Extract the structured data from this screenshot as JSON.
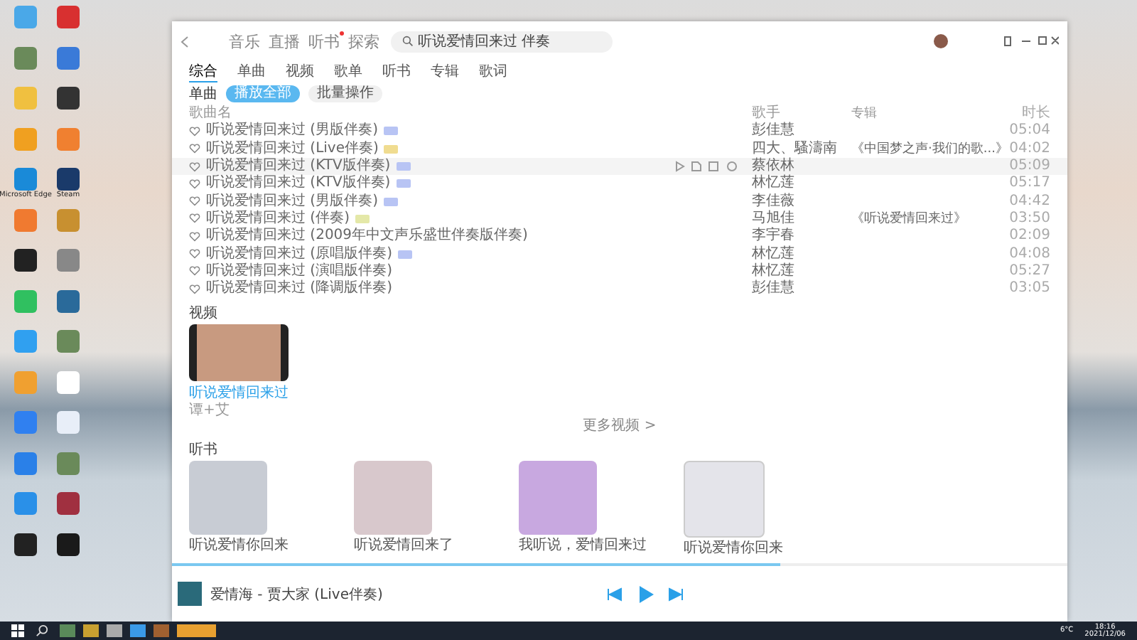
{
  "desktop_icons": [
    {
      "color": "#4aa8e8"
    },
    {
      "color": "#d83030"
    },
    {
      "color": "#6a8a5a"
    },
    {
      "color": "#3a7ad8"
    },
    {
      "color": "#f0c040"
    },
    {
      "color": "#333333"
    },
    {
      "color": "#f0a020"
    },
    {
      "color": "#f08030"
    },
    {
      "color": "#1a8ad8",
      "label": "Microsoft Edge"
    },
    {
      "color": "#1a3a6a",
      "label": "Steam"
    },
    {
      "color": "#f07a30"
    },
    {
      "color": "#c89030"
    },
    {
      "color": "#222222"
    },
    {
      "color": "#888888"
    },
    {
      "color": "#30c060"
    },
    {
      "color": "#2a6a9a"
    },
    {
      "color": "#30a0f0"
    },
    {
      "color": "#6a8a5a"
    },
    {
      "color": "#f0a030"
    },
    {
      "color": "#ffffff"
    },
    {
      "color": "#3080f0"
    },
    {
      "color": "#e8eef8"
    },
    {
      "color": "#2a80e8"
    },
    {
      "color": "#6a8a5a"
    },
    {
      "color": "#2a90e8"
    },
    {
      "color": "#a03040"
    },
    {
      "color": "#222222"
    },
    {
      "color": "#1a1a1a"
    }
  ],
  "window": {
    "nav": [
      {
        "label": "音乐",
        "dot": false
      },
      {
        "label": "直播",
        "dot": false
      },
      {
        "label": "听书",
        "dot": true
      },
      {
        "label": "探索",
        "dot": false
      }
    ],
    "search": {
      "value": "听说爱情回来过 伴奏"
    },
    "tabs": [
      {
        "label": "综合",
        "selected": true
      },
      {
        "label": "单曲",
        "selected": false
      },
      {
        "label": "视频",
        "selected": false
      },
      {
        "label": "歌单",
        "selected": false
      },
      {
        "label": "听书",
        "selected": false
      },
      {
        "label": "专辑",
        "selected": false
      },
      {
        "label": "歌词",
        "selected": false
      }
    ],
    "section_label": "单曲",
    "buttons": [
      "播放全部",
      "批量操作"
    ],
    "columns": [
      "歌曲名",
      "歌手",
      "专辑",
      "时长"
    ],
    "rows": [
      {
        "title": "听说爱情回来过 (男版伴奏)",
        "color": "#b8c4f4",
        "artist": "彭佳慧",
        "album": "",
        "time": "05:04",
        "hovered": false
      },
      {
        "title": "听说爱情回来过 (Live伴奏)",
        "color": "#f0dc90",
        "artist": "四大、騷濤南",
        "album": "《中国梦之声·我们的歌...》",
        "time": "04:02",
        "hovered": false
      },
      {
        "title": "听说爱情回来过 (KTV版伴奏)",
        "color": "#b8c4f4",
        "artist": "蔡依林",
        "album": "",
        "time": "05:09",
        "hovered": true
      },
      {
        "title": "听说爱情回来过 (KTV版伴奏)",
        "color": "#b8c4f4",
        "artist": "林忆莲",
        "album": "",
        "time": "05:17",
        "hovered": false
      },
      {
        "title": "听说爱情回来过 (男版伴奏)",
        "color": "#b8c4f4",
        "artist": "李佳薇",
        "album": "",
        "time": "04:42",
        "hovered": false
      },
      {
        "title": "听说爱情回来过 (伴奏)",
        "color": "#e4e8a8",
        "artist": "马旭佳",
        "album": "《听说爱情回来过》",
        "time": "03:50",
        "hovered": false
      },
      {
        "title": "听说爱情回来过 (2009年中文声乐盛世伴奏版伴奏)",
        "artist": "李宇春",
        "album": "",
        "time": "02:09",
        "hovered": false
      },
      {
        "title": "听说爱情回来过 (原唱版伴奏)",
        "color": "#b8c4f4",
        "artist": "林忆莲",
        "album": "",
        "time": "04:08",
        "hovered": false
      },
      {
        "title": "听说爱情回来过 (演唱版伴奏)",
        "artist": "林忆莲",
        "album": "",
        "time": "05:27",
        "hovered": false
      },
      {
        "title": "听说爱情回来过 (降调版伴奏)",
        "artist": "彭佳慧",
        "album": "",
        "time": "03:05",
        "hovered": false
      }
    ],
    "video": {
      "heading": "视频",
      "title": "听说爱情回来过",
      "sub": "谭+艾",
      "more": "更多视频 >"
    },
    "books": {
      "heading": "听书",
      "items": [
        "听说爱情你回来",
        "听说爱情回来了",
        "我听说，爱情回来过",
        "听说爱情你回来"
      ]
    },
    "player": {
      "title": "爱情海 - 贾大家 (Live伴奏)",
      "level": 0.68
    }
  },
  "taskbar": {
    "weather": "6°C",
    "time": "18:16",
    "date": "2021/12/06"
  }
}
